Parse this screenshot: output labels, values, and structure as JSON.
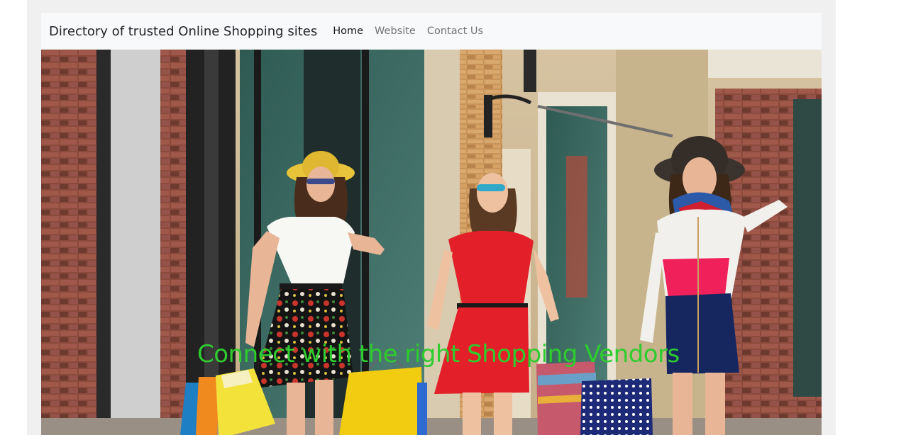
{
  "navbar": {
    "brand": "Directory of trusted Online Shopping sites",
    "links": [
      {
        "label": "Home",
        "active": true
      },
      {
        "label": "Website",
        "active": false
      },
      {
        "label": "Contact Us",
        "active": false
      }
    ]
  },
  "hero": {
    "caption": "Connect with the right Shopping Vendors",
    "caption_color": "#2ecc2e"
  },
  "colors": {
    "page_bg": "#ffffff",
    "container_bg": "#f0f0f0",
    "navbar_bg": "#f8f9fa"
  }
}
